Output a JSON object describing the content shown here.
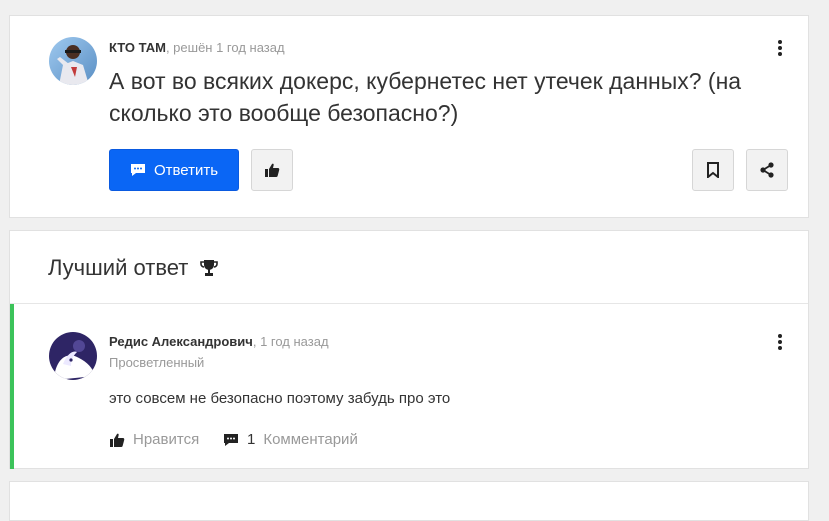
{
  "question": {
    "author": "КТО ТАМ",
    "meta_suffix": ", решён 1 год назад",
    "text": "А вот во всяких докерс, кубернетес нет утечек данных? (на сколько это вообще безопасно?)",
    "reply_label": "Ответить"
  },
  "best_answer": {
    "title": "Лучший ответ",
    "author": "Редис Александрович",
    "meta_suffix": ", 1 год назад",
    "level": "Просветленный",
    "text": "это совсем не безопасно поэтому забудь про это",
    "like_label": "Нравится",
    "comment_count": "1",
    "comment_label": "Комментарий"
  },
  "colors": {
    "primary": "#0a66f5",
    "accent_green": "#3cc35a",
    "muted": "#999999"
  }
}
